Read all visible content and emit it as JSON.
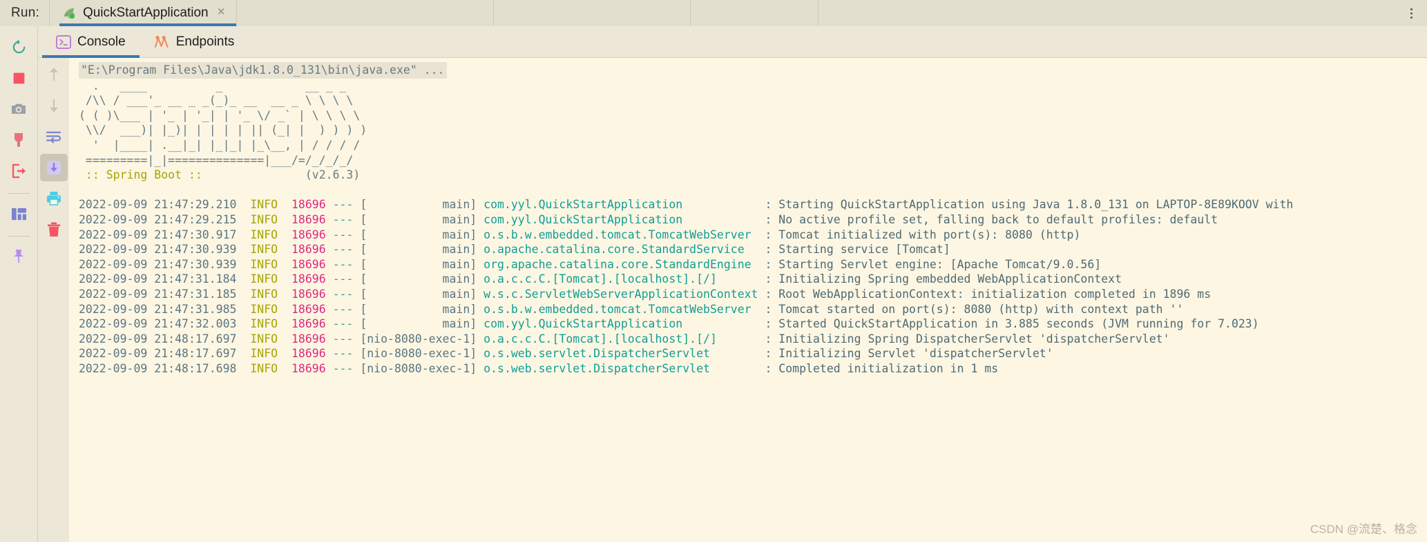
{
  "runbar": {
    "label": "Run:",
    "tab_title": "QuickStartApplication",
    "close_label": "×",
    "more_label": "more-options"
  },
  "toolbar_left": [
    {
      "name": "rerun-icon",
      "label": "Rerun"
    },
    {
      "name": "stop-icon",
      "label": "Stop"
    },
    {
      "name": "camera-icon",
      "label": "Take Thread Dump"
    },
    {
      "name": "plug-icon",
      "label": "Attach Profiler"
    },
    {
      "name": "exit-icon",
      "label": "Exit"
    },
    {
      "name": "layout-icon",
      "label": "Layout Settings"
    },
    {
      "name": "pin-icon",
      "label": "Pin Tab"
    }
  ],
  "toolbar_console": [
    {
      "name": "arrow-up-icon",
      "label": "Up the Stack Trace"
    },
    {
      "name": "arrow-down-icon",
      "label": "Down the Stack Trace"
    },
    {
      "name": "soft-wrap-icon",
      "label": "Soft-Wrap"
    },
    {
      "name": "scroll-to-end-icon",
      "label": "Scroll to the End"
    },
    {
      "name": "print-icon",
      "label": "Print"
    },
    {
      "name": "trash-icon",
      "label": "Clear All"
    }
  ],
  "tabs": [
    {
      "name": "tab-console",
      "label": "Console",
      "icon": "console-icon",
      "active": true
    },
    {
      "name": "tab-endpoints",
      "label": "Endpoints",
      "icon": "endpoints-icon",
      "active": false
    }
  ],
  "console": {
    "command_line": "\"E:\\Program Files\\Java\\jdk1.8.0_131\\bin\\java.exe\" ...",
    "banner": [
      "  .   ____          _            __ _ _",
      " /\\\\ / ___'_ __ _ _(_)_ __  __ _ \\ \\ \\ \\",
      "( ( )\\___ | '_ | '_| | '_ \\/ _` | \\ \\ \\ \\",
      " \\\\/  ___)| |_)| | | | | || (_| |  ) ) ) )",
      "  '  |____| .__|_| |_|_| |_\\__, | / / / /",
      " =========|_|==============|___/=/_/_/_/"
    ],
    "spring_boot_label": " :: Spring Boot :: ",
    "spring_boot_version": "(v2.6.3)",
    "log_lines": [
      {
        "timestamp": "2022-09-09 21:47:29.210",
        "level": "INFO",
        "pid": "18696",
        "thread": "main",
        "logger": "com.yyl.QuickStartApplication",
        "message": "Starting QuickStartApplication using Java 1.8.0_131 on LAPTOP-8E89KOOV with"
      },
      {
        "timestamp": "2022-09-09 21:47:29.215",
        "level": "INFO",
        "pid": "18696",
        "thread": "main",
        "logger": "com.yyl.QuickStartApplication",
        "message": "No active profile set, falling back to default profiles: default"
      },
      {
        "timestamp": "2022-09-09 21:47:30.917",
        "level": "INFO",
        "pid": "18696",
        "thread": "main",
        "logger": "o.s.b.w.embedded.tomcat.TomcatWebServer",
        "message": "Tomcat initialized with port(s): 8080 (http)"
      },
      {
        "timestamp": "2022-09-09 21:47:30.939",
        "level": "INFO",
        "pid": "18696",
        "thread": "main",
        "logger": "o.apache.catalina.core.StandardService",
        "message": "Starting service [Tomcat]"
      },
      {
        "timestamp": "2022-09-09 21:47:30.939",
        "level": "INFO",
        "pid": "18696",
        "thread": "main",
        "logger": "org.apache.catalina.core.StandardEngine",
        "message": "Starting Servlet engine: [Apache Tomcat/9.0.56]"
      },
      {
        "timestamp": "2022-09-09 21:47:31.184",
        "level": "INFO",
        "pid": "18696",
        "thread": "main",
        "logger": "o.a.c.c.C.[Tomcat].[localhost].[/]",
        "message": "Initializing Spring embedded WebApplicationContext"
      },
      {
        "timestamp": "2022-09-09 21:47:31.185",
        "level": "INFO",
        "pid": "18696",
        "thread": "main",
        "logger": "w.s.c.ServletWebServerApplicationContext",
        "message": "Root WebApplicationContext: initialization completed in 1896 ms"
      },
      {
        "timestamp": "2022-09-09 21:47:31.985",
        "level": "INFO",
        "pid": "18696",
        "thread": "main",
        "logger": "o.s.b.w.embedded.tomcat.TomcatWebServer",
        "message": "Tomcat started on port(s): 8080 (http) with context path ''"
      },
      {
        "timestamp": "2022-09-09 21:47:32.003",
        "level": "INFO",
        "pid": "18696",
        "thread": "main",
        "logger": "com.yyl.QuickStartApplication",
        "message": "Started QuickStartApplication in 3.885 seconds (JVM running for 7.023)"
      },
      {
        "timestamp": "2022-09-09 21:48:17.697",
        "level": "INFO",
        "pid": "18696",
        "thread": "nio-8080-exec-1",
        "logger": "o.a.c.c.C.[Tomcat].[localhost].[/]",
        "message": "Initializing Spring DispatcherServlet 'dispatcherServlet'"
      },
      {
        "timestamp": "2022-09-09 21:48:17.697",
        "level": "INFO",
        "pid": "18696",
        "thread": "nio-8080-exec-1",
        "logger": "o.s.web.servlet.DispatcherServlet",
        "message": "Initializing Servlet 'dispatcherServlet'"
      },
      {
        "timestamp": "2022-09-09 21:48:17.698",
        "level": "INFO",
        "pid": "18696",
        "thread": "nio-8080-exec-1",
        "logger": "o.s.web.servlet.DispatcherServlet",
        "message": "Completed initialization in 1 ms"
      }
    ]
  },
  "watermark": "CSDN @流楚、格念",
  "colors": {
    "console_bg": "#fdf6e3",
    "chrome_bg": "#ece7d7",
    "tab_underline": "#3c78b4",
    "logger": "#0f9e96",
    "pid": "#e0277f",
    "level": "#a6a500",
    "timestamp": "#5a7683",
    "message": "#4e6a74",
    "stop_red": "#f75464",
    "print_cyan": "#4ecde5"
  }
}
